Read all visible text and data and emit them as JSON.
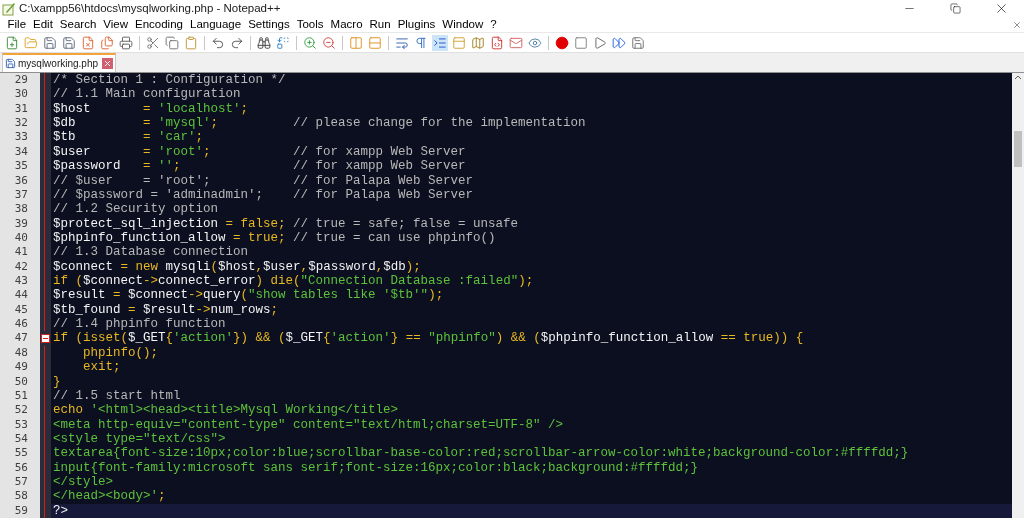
{
  "window": {
    "title": "C:\\xampp56\\htdocs\\mysqlworking.php - Notepad++"
  },
  "menu": [
    "File",
    "Edit",
    "Search",
    "View",
    "Encoding",
    "Language",
    "Settings",
    "Tools",
    "Macro",
    "Run",
    "Plugins",
    "Window",
    "?"
  ],
  "tabs": [
    {
      "label": "mysqlworking.php",
      "selected": true
    }
  ],
  "editor": {
    "lines": [
      {
        "number": "29",
        "current": false,
        "fold_start": false,
        "segments": [
          {
            "kind": "comment",
            "text": "/* Section 1 : Configuration */"
          }
        ]
      },
      {
        "number": "30",
        "current": false,
        "fold_start": false,
        "segments": [
          {
            "kind": "comment",
            "text": "// 1.1 Main configuration"
          }
        ]
      },
      {
        "number": "31",
        "current": false,
        "fold_start": false,
        "segments": [
          {
            "kind": "plain",
            "text": "$host       "
          },
          {
            "kind": "op",
            "text": "= "
          },
          {
            "kind": "string",
            "text": "'localhost'"
          },
          {
            "kind": "op",
            "text": ";"
          }
        ]
      },
      {
        "number": "32",
        "current": false,
        "fold_start": false,
        "segments": [
          {
            "kind": "plain",
            "text": "$db         "
          },
          {
            "kind": "op",
            "text": "= "
          },
          {
            "kind": "string",
            "text": "'mysql'"
          },
          {
            "kind": "op",
            "text": ";"
          },
          {
            "kind": "comment",
            "text": "          // please change for the implementation"
          }
        ]
      },
      {
        "number": "33",
        "current": false,
        "fold_start": false,
        "segments": [
          {
            "kind": "plain",
            "text": "$tb         "
          },
          {
            "kind": "op",
            "text": "= "
          },
          {
            "kind": "string",
            "text": "'car'"
          },
          {
            "kind": "op",
            "text": ";"
          }
        ]
      },
      {
        "number": "34",
        "current": false,
        "fold_start": false,
        "segments": [
          {
            "kind": "plain",
            "text": "$user       "
          },
          {
            "kind": "op",
            "text": "= "
          },
          {
            "kind": "string",
            "text": "'root'"
          },
          {
            "kind": "op",
            "text": ";"
          },
          {
            "kind": "comment",
            "text": "           // for xampp Web Server"
          }
        ]
      },
      {
        "number": "35",
        "current": false,
        "fold_start": false,
        "segments": [
          {
            "kind": "plain",
            "text": "$password   "
          },
          {
            "kind": "op",
            "text": "= "
          },
          {
            "kind": "string",
            "text": "''"
          },
          {
            "kind": "op",
            "text": ";"
          },
          {
            "kind": "comment",
            "text": "               // for xampp Web Server"
          }
        ]
      },
      {
        "number": "36",
        "current": false,
        "fold_start": false,
        "segments": [
          {
            "kind": "comment",
            "text": "// $user    = 'root';           // for Palapa Web Server"
          }
        ]
      },
      {
        "number": "37",
        "current": false,
        "fold_start": false,
        "segments": [
          {
            "kind": "comment",
            "text": "// $password = 'adminadmin';    // for Palapa Web Server"
          }
        ]
      },
      {
        "number": "38",
        "current": false,
        "fold_start": false,
        "segments": [
          {
            "kind": "comment",
            "text": "// 1.2 Security option"
          }
        ]
      },
      {
        "number": "39",
        "current": false,
        "fold_start": false,
        "segments": [
          {
            "kind": "plain",
            "text": "$protect_sql_injection "
          },
          {
            "kind": "op",
            "text": "= false;"
          },
          {
            "kind": "comment",
            "text": " // true = safe; false = unsafe"
          }
        ]
      },
      {
        "number": "40",
        "current": false,
        "fold_start": false,
        "segments": [
          {
            "kind": "plain",
            "text": "$phpinfo_function_allow "
          },
          {
            "kind": "op",
            "text": "= true;"
          },
          {
            "kind": "comment",
            "text": " // true = can use phpinfo()"
          }
        ]
      },
      {
        "number": "41",
        "current": false,
        "fold_start": false,
        "segments": [
          {
            "kind": "comment",
            "text": "// 1.3 Database connection"
          }
        ]
      },
      {
        "number": "42",
        "current": false,
        "fold_start": false,
        "segments": [
          {
            "kind": "plain",
            "text": "$connect "
          },
          {
            "kind": "op",
            "text": "= new "
          },
          {
            "kind": "plain",
            "text": "mysqli"
          },
          {
            "kind": "op",
            "text": "("
          },
          {
            "kind": "plain",
            "text": "$host"
          },
          {
            "kind": "op",
            "text": ","
          },
          {
            "kind": "plain",
            "text": "$user"
          },
          {
            "kind": "op",
            "text": ","
          },
          {
            "kind": "plain",
            "text": "$password"
          },
          {
            "kind": "op",
            "text": ","
          },
          {
            "kind": "plain",
            "text": "$db"
          },
          {
            "kind": "op",
            "text": ");"
          }
        ]
      },
      {
        "number": "43",
        "current": false,
        "fold_start": false,
        "segments": [
          {
            "kind": "op",
            "text": "if ("
          },
          {
            "kind": "plain",
            "text": "$connect"
          },
          {
            "kind": "op",
            "text": "->"
          },
          {
            "kind": "plain",
            "text": "connect_error"
          },
          {
            "kind": "op",
            "text": ") die("
          },
          {
            "kind": "string",
            "text": "\"Connection Database :failed\""
          },
          {
            "kind": "op",
            "text": ");"
          }
        ]
      },
      {
        "number": "44",
        "current": false,
        "fold_start": false,
        "segments": [
          {
            "kind": "plain",
            "text": "$result "
          },
          {
            "kind": "op",
            "text": "= "
          },
          {
            "kind": "plain",
            "text": "$connect"
          },
          {
            "kind": "op",
            "text": "->"
          },
          {
            "kind": "plain",
            "text": "query"
          },
          {
            "kind": "op",
            "text": "("
          },
          {
            "kind": "string",
            "text": "\"show tables like '$tb'\""
          },
          {
            "kind": "op",
            "text": ");"
          }
        ]
      },
      {
        "number": "45",
        "current": false,
        "fold_start": false,
        "segments": [
          {
            "kind": "plain",
            "text": "$tb_found "
          },
          {
            "kind": "op",
            "text": "= "
          },
          {
            "kind": "plain",
            "text": "$result"
          },
          {
            "kind": "op",
            "text": "->"
          },
          {
            "kind": "plain",
            "text": "num_rows"
          },
          {
            "kind": "op",
            "text": ";"
          }
        ]
      },
      {
        "number": "46",
        "current": false,
        "fold_start": false,
        "segments": [
          {
            "kind": "comment",
            "text": "// 1.4 phpinfo function"
          }
        ]
      },
      {
        "number": "47",
        "current": false,
        "fold_start": true,
        "segments": [
          {
            "kind": "op",
            "text": "if (isset("
          },
          {
            "kind": "plain",
            "text": "$_GET"
          },
          {
            "kind": "op",
            "text": "{"
          },
          {
            "kind": "string",
            "text": "'action'"
          },
          {
            "kind": "op",
            "text": "}) && ("
          },
          {
            "kind": "plain",
            "text": "$_GET"
          },
          {
            "kind": "op",
            "text": "{"
          },
          {
            "kind": "string",
            "text": "'action'"
          },
          {
            "kind": "op",
            "text": "} == "
          },
          {
            "kind": "string",
            "text": "\"phpinfo\""
          },
          {
            "kind": "op",
            "text": ") && ("
          },
          {
            "kind": "plain",
            "text": "$phpinfo_function_allow"
          },
          {
            "kind": "op",
            "text": " == true)) {"
          }
        ]
      },
      {
        "number": "48",
        "current": false,
        "fold_start": false,
        "segments": [
          {
            "kind": "op",
            "text": "    phpinfo();"
          }
        ]
      },
      {
        "number": "49",
        "current": false,
        "fold_start": false,
        "segments": [
          {
            "kind": "op",
            "text": "    exit;"
          }
        ]
      },
      {
        "number": "50",
        "current": false,
        "fold_start": false,
        "segments": [
          {
            "kind": "op",
            "text": "}"
          }
        ]
      },
      {
        "number": "51",
        "current": false,
        "fold_start": false,
        "segments": [
          {
            "kind": "comment",
            "text": "// 1.5 start html"
          }
        ]
      },
      {
        "number": "52",
        "current": false,
        "fold_start": false,
        "segments": [
          {
            "kind": "op",
            "text": "echo "
          },
          {
            "kind": "string",
            "text": "'<html><head><title>Mysql Working</title>"
          }
        ]
      },
      {
        "number": "53",
        "current": false,
        "fold_start": false,
        "segments": [
          {
            "kind": "string",
            "text": "<meta http-equiv=\"content-type\" content=\"text/html;charset=UTF-8\" />"
          }
        ]
      },
      {
        "number": "54",
        "current": false,
        "fold_start": false,
        "segments": [
          {
            "kind": "string",
            "text": "<style type=\"text/css\">"
          }
        ]
      },
      {
        "number": "55",
        "current": false,
        "fold_start": false,
        "segments": [
          {
            "kind": "string",
            "text": "textarea{font-size:10px;color:blue;scrollbar-base-color:red;scrollbar-arrow-color:white;background-color:#ffffdd;}"
          }
        ]
      },
      {
        "number": "56",
        "current": false,
        "fold_start": false,
        "segments": [
          {
            "kind": "string",
            "text": "input{font-family:microsoft sans serif;font-size:16px;color:black;background:#ffffdd;}"
          }
        ]
      },
      {
        "number": "57",
        "current": false,
        "fold_start": false,
        "segments": [
          {
            "kind": "string",
            "text": "</style>"
          }
        ]
      },
      {
        "number": "58",
        "current": false,
        "fold_start": false,
        "segments": [
          {
            "kind": "string",
            "text": "</head><body>'"
          },
          {
            "kind": "op",
            "text": ";"
          }
        ]
      },
      {
        "number": "59",
        "current": true,
        "fold_start": false,
        "segments": [
          {
            "kind": "plain",
            "text": "?>"
          }
        ]
      }
    ]
  }
}
